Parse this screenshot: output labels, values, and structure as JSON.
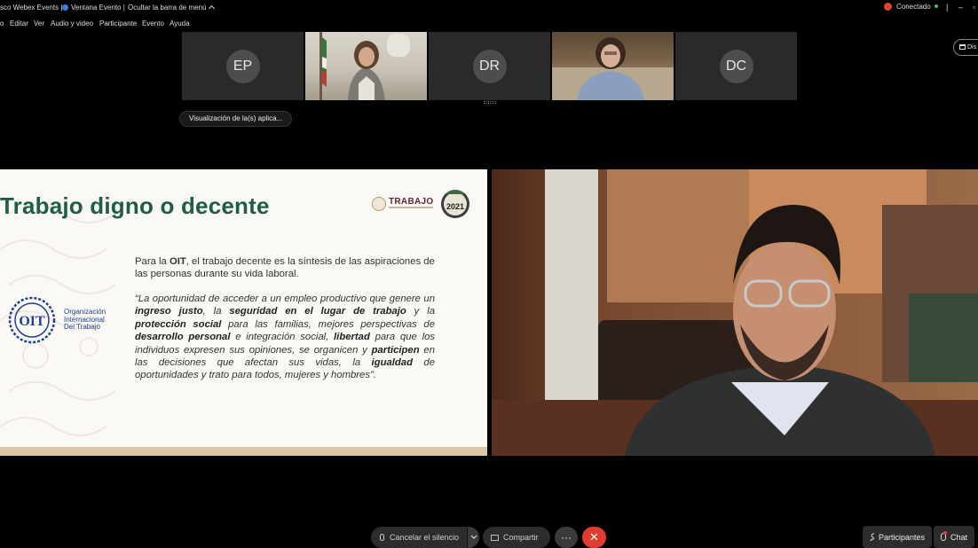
{
  "titlebar": {
    "app_name": "sco Webex Events",
    "window_label": "Ventana Evento",
    "hide_menu": "Ocultar la barra de menú",
    "status": "Conectado",
    "status_color": "#3fbf6a",
    "record_color": "#e0403a"
  },
  "menu": [
    "o",
    "Editar",
    "Ver",
    "Audio y video",
    "Participante",
    "Evento",
    "Ayuda"
  ],
  "participants": [
    {
      "initials": "EP",
      "type": "avatar"
    },
    {
      "initials": "",
      "type": "video"
    },
    {
      "initials": "DR",
      "type": "avatar"
    },
    {
      "initials": "",
      "type": "video"
    },
    {
      "initials": "DC",
      "type": "avatar"
    }
  ],
  "app_visualization_label": "Visualización de la(s) aplica...",
  "right_pill_label": "Dis",
  "slide": {
    "title": "Trabajo digno o decente",
    "logo_word": "TRABAJO",
    "badge_year": "2021",
    "para1_pre": "Para la ",
    "para1_bold": "OIT",
    "para1_post": ", el trabajo decente es la síntesis de las aspiraciones de las personas durante su vida laboral.",
    "quote": [
      {
        "t": "“La oportunidad de acceder a un empleo productivo que genere un ",
        "b": false
      },
      {
        "t": "ingreso justo",
        "b": true
      },
      {
        "t": ", la ",
        "b": false
      },
      {
        "t": "seguridad en el lugar de trabajo",
        "b": true
      },
      {
        "t": " y la ",
        "b": false
      },
      {
        "t": "protección social",
        "b": true
      },
      {
        "t": " para las familias, mejores perspectivas de ",
        "b": false
      },
      {
        "t": "desarrollo personal",
        "b": true
      },
      {
        "t": " e integración social, ",
        "b": false
      },
      {
        "t": "libertad",
        "b": true
      },
      {
        "t": " para que los individuos expresen sus opiniones, se organicen y ",
        "b": false
      },
      {
        "t": "participen",
        "b": true
      },
      {
        "t": " en las decisiones que afectan sus vidas, la ",
        "b": false
      },
      {
        "t": "igualdad",
        "b": true
      },
      {
        "t": " de oportunidades y trato para todos, mujeres y hombres”.",
        "b": false
      }
    ],
    "oit_abbrev": "OIT",
    "oit_name_lines": [
      "Organización",
      "Internacional",
      "Del Trabajo"
    ],
    "title_color": "#1f5d47",
    "oit_color": "#1f3f8f"
  },
  "controls": {
    "mute_label": "Cancelar el silencio",
    "share_label": "Compartir",
    "more_label": "···",
    "leave_label": "✕",
    "participants_label": "Participantes",
    "chat_label": "Chat",
    "leave_color": "#e03c31"
  }
}
